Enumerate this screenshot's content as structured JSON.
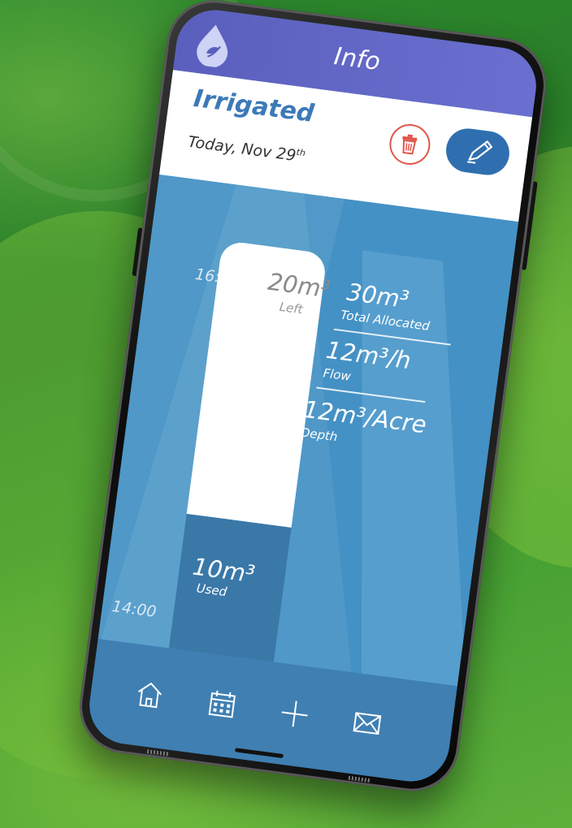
{
  "app_bar": {
    "title": "Info"
  },
  "header": {
    "status": "Irrigated",
    "date_main": "Today, Nov 29",
    "date_suffix": "th"
  },
  "chart": {
    "time_top": "16:00",
    "time_bottom": "14:00",
    "left": {
      "value": "20m³",
      "label": "Left"
    },
    "used": {
      "value": "10m³",
      "label": "Used"
    },
    "total": {
      "value": "30m³",
      "label": "Total Allocated"
    },
    "flow": {
      "value": "12m³/h",
      "label": "Flow"
    },
    "depth": {
      "value": "12m³/Acre",
      "label": "Depth"
    },
    "used_fraction": 0.3333
  },
  "nav": {
    "items": [
      {
        "icon": "home-icon"
      },
      {
        "icon": "calendar-icon"
      },
      {
        "icon": "plus-icon"
      },
      {
        "icon": "mail-icon"
      }
    ]
  },
  "colors": {
    "app_bar": "#6b6fd0",
    "status_text": "#3c79b8",
    "trash": "#e2554a",
    "edit": "#2f6fb0",
    "content_bg": "#4f98c8",
    "used_bar": "#3a78a8",
    "nav_bg": "#3f7fb2"
  }
}
